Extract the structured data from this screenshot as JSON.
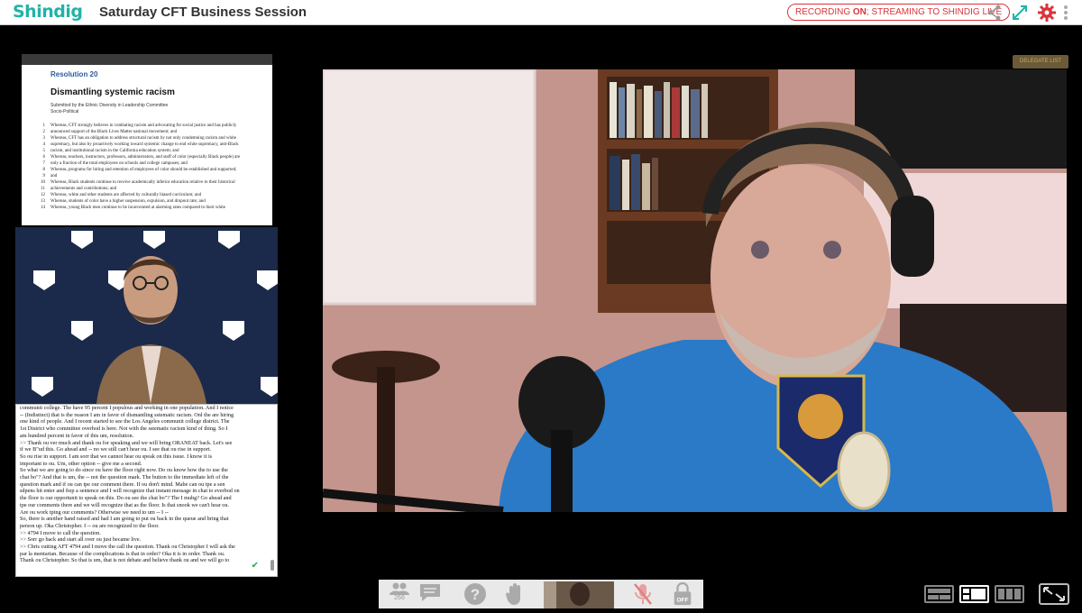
{
  "header": {
    "logo": "Shindig",
    "title": "Saturday CFT Business Session",
    "recording_prefix": "RECORDING ",
    "recording_on": "ON",
    "recording_suffix": "; STREAMING TO SHINDIG LIVE",
    "icons": [
      "share-icon",
      "expand-icon",
      "gear-icon",
      "more-icon"
    ]
  },
  "stage": {
    "delegate_button": "DELEGATE LIST"
  },
  "document": {
    "resolution_number": "Resolution 20",
    "resolution_title": "Dismantling systemic racism",
    "submitted_by": "Submitted by the Ethnic Diversity in Leadership Committee",
    "category": "Socio-Political",
    "lines": [
      {
        "n": "1",
        "text": "Whereas, CFT strongly believes in combating racism and advocating for social justice and has publicly"
      },
      {
        "n": "2",
        "text": "announced support of the Black Lives Matter national movement; and"
      },
      {
        "n": "3",
        "text": "Whereas, CFT has an obligation to address structural racism by not only condemning racism and white"
      },
      {
        "n": "4",
        "text": "supremacy, but also by proactively working toward systemic change to end white supremacy, anti-Black"
      },
      {
        "n": "5",
        "text": "racism, and institutional racism in the California education system; and"
      },
      {
        "n": "6",
        "text": "Whereas, teachers, instructors, professors, administrators, and staff of color (especially Black people) are"
      },
      {
        "n": "7",
        "text": "only a fraction of the total employees on schools and college campuses; and"
      },
      {
        "n": "8",
        "text": "Whereas, programs for hiring and retention of employees of color should be established and supported;"
      },
      {
        "n": "9",
        "text": "and"
      },
      {
        "n": "10",
        "text": "Whereas, Black students continue to receive academically inferior education relative to their historical"
      },
      {
        "n": "11",
        "text": "achievements and contributions; and"
      },
      {
        "n": "12",
        "text": "Whereas, white and other students are affected by culturally biased curriculum; and"
      },
      {
        "n": "13",
        "text": "Whereas, students of color have a higher suspension, expulsion, and dropout rate; and"
      },
      {
        "n": "14",
        "text": "Whereas, young Black men continue to be incarcerated at alarming rates compared to their white"
      }
    ]
  },
  "transcript": {
    "lines": [
      "communit college. The have 95 percent I populous and working in one population. And I notice",
      "-- (Indistinct) that is the reason I am in favor of dismantling sstematic racism. Onl the are hiring",
      "one kind of people. And I recent started to see the Los Angeles communit college district. The",
      "1st District who committee overhod is here. Not with the sstematic racism kind of thing. So I",
      "am hundred percent in favor of this um, resolution.",
      ">> Thank ou ver much and thank ou for speaking and we will bring ORANEAT back. Let's see",
      "if we B\"ud this. Go ahead and -- no we still can't hear ou. I see that ou rise in support.",
      "So ou rise in support. I am sorr that we cannot hear ou speak on this issue. I know it is",
      "important to ou. Um, other option -- give me a second.",
      "So what we are going to do since ou have the floor right now. Do ou know how the to use the",
      "chat bo\"? And that is um, the -- not the question mark. The button to the immediate left of the",
      "question mark and if ou can tpe our comment there. If ou don't mind. Mabe can ou tpe a sen",
      "sdpens hit enter and fiep a sentence and I will recognize that instant message in chat to everbod on",
      "the floor is our opportunit to speak on this. Do ou see the chat bo\"? The I mubg? Go ahead and",
      "tpe our comments there and we will recognize that as the floor. Is that snook we can't hear ou.",
      "Are ou work tping our comments? Otherwise we need to um -- I --",
      "So, there is another hand raised and had I am going to put ou back in the queue and bring that",
      "person up. Oka Christopher. I -- ou are recognized to the floor.",
      ">> 4794 I move to call the question.",
      ">> Sorr go back and start all over ou just became live.",
      ">> Chris cutting AFT 4794 and I move the call the question. Thank ou Christopher I will ask the",
      "par la mentarian. Because of the complications is that in order? Oka it is in order. Thank ou.",
      "Thank ou Christopher. So that is um, that is not debate and believe thank ou and we will go to"
    ]
  },
  "toolbar": {
    "participants_count": "266",
    "lock_label": "OFF"
  },
  "colors": {
    "brand": "#21b3a8",
    "recording": "#d9343a",
    "gear": "#d9343a"
  }
}
